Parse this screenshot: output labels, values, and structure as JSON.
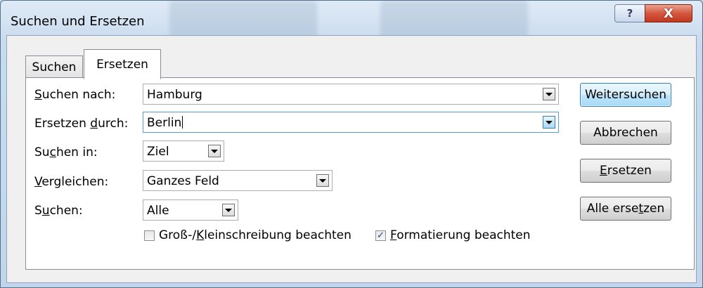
{
  "window": {
    "title": "Suchen und Ersetzen",
    "help_glyph": "?",
    "close_glyph": "X"
  },
  "tabs": [
    {
      "label": "Suchen",
      "active": false
    },
    {
      "label": "Ersetzen",
      "active": true
    }
  ],
  "fields": {
    "find_label_pre": "",
    "find_label_u": "S",
    "find_label_post": "uchen nach:",
    "find_value": "Hamburg",
    "replace_label_pre": "Ersetzen ",
    "replace_label_u": "d",
    "replace_label_post": "urch:",
    "replace_value": "Berlin",
    "lookin_label_pre": "Su",
    "lookin_label_u": "c",
    "lookin_label_post": "hen in:",
    "lookin_value": "Ziel",
    "match_label_pre": "",
    "match_label_u": "V",
    "match_label_post": "ergleichen:",
    "match_value": "Ganzes Feld",
    "search_label_pre": "S",
    "search_label_u": "u",
    "search_label_post": "chen:",
    "search_value": "Alle"
  },
  "checkboxes": {
    "case": {
      "pre": "Groß-/",
      "u": "K",
      "post": "leinschreibung beachten",
      "checked": false
    },
    "format": {
      "pre": "",
      "u": "F",
      "post": "ormatierung beachten",
      "checked": true,
      "mark": "✓"
    }
  },
  "buttons": {
    "find_next": "Weitersuchen",
    "cancel": "Abbrechen",
    "replace_u": "E",
    "replace_rest": "rsetzen",
    "replace_all_pre": "Alle erse",
    "replace_all_u": "t",
    "replace_all_post": "zen"
  }
}
